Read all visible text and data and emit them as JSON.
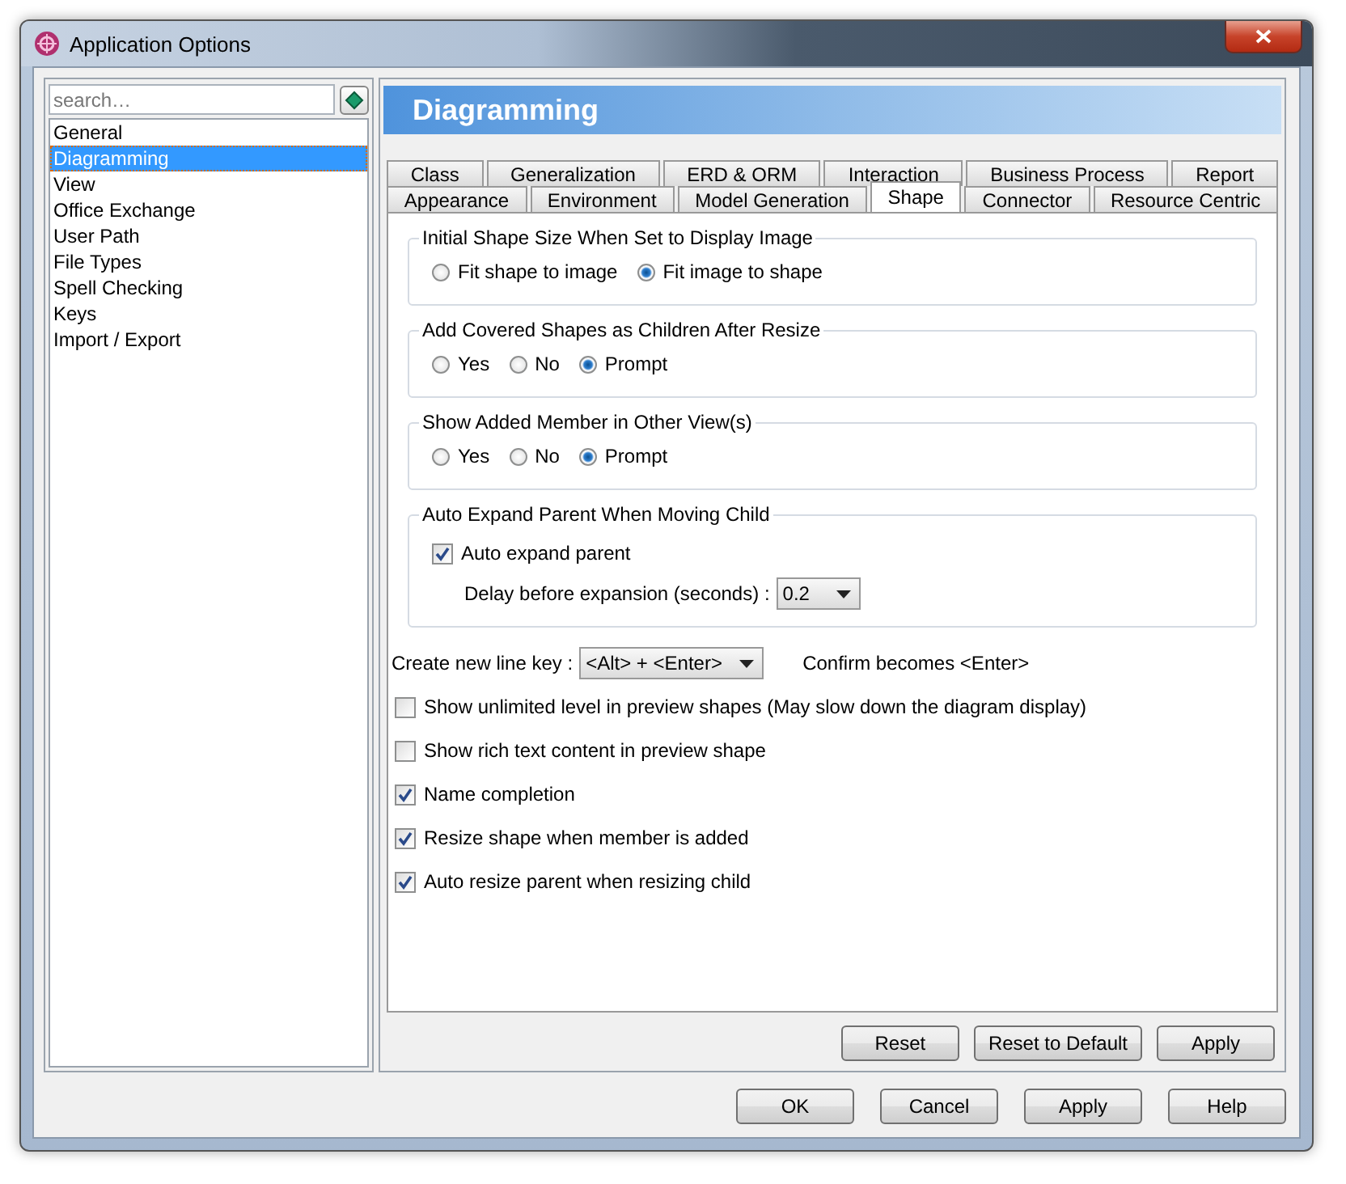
{
  "window": {
    "title": "Application Options"
  },
  "sidebar": {
    "search": {
      "placeholder": "search…"
    },
    "items": [
      {
        "label": "General",
        "selected": false
      },
      {
        "label": "Diagramming",
        "selected": true
      },
      {
        "label": "View",
        "selected": false
      },
      {
        "label": "Office Exchange",
        "selected": false
      },
      {
        "label": "User Path",
        "selected": false
      },
      {
        "label": "File Types",
        "selected": false
      },
      {
        "label": "Spell Checking",
        "selected": false
      },
      {
        "label": "Keys",
        "selected": false
      },
      {
        "label": "Import / Export",
        "selected": false
      }
    ]
  },
  "panel": {
    "title": "Diagramming",
    "tab_rows": [
      [
        {
          "label": "Class",
          "selected": false
        },
        {
          "label": "Generalization",
          "selected": false
        },
        {
          "label": "ERD & ORM",
          "selected": false
        },
        {
          "label": "Interaction",
          "selected": false
        },
        {
          "label": "Business Process",
          "selected": false
        },
        {
          "label": "Report",
          "selected": false
        }
      ],
      [
        {
          "label": "Appearance",
          "selected": false
        },
        {
          "label": "Environment",
          "selected": false
        },
        {
          "label": "Model Generation",
          "selected": false
        },
        {
          "label": "Shape",
          "selected": true
        },
        {
          "label": "Connector",
          "selected": false
        },
        {
          "label": "Resource Centric",
          "selected": false
        }
      ]
    ],
    "groups": [
      {
        "kind": "radios",
        "title": "Initial Shape Size When Set to Display Image",
        "options": [
          {
            "label": "Fit shape to image",
            "selected": false
          },
          {
            "label": "Fit image to shape",
            "selected": true
          }
        ]
      },
      {
        "kind": "radios",
        "title": "Add Covered Shapes as Children After Resize",
        "options": [
          {
            "label": "Yes",
            "selected": false
          },
          {
            "label": "No",
            "selected": false
          },
          {
            "label": "Prompt",
            "selected": true
          }
        ]
      },
      {
        "kind": "radios",
        "title": "Show Added Member in Other View(s)",
        "options": [
          {
            "label": "Yes",
            "selected": false
          },
          {
            "label": "No",
            "selected": false
          },
          {
            "label": "Prompt",
            "selected": true
          }
        ]
      },
      {
        "kind": "expand",
        "title": "Auto Expand Parent When Moving Child",
        "checkbox": {
          "label": "Auto expand parent",
          "checked": true
        },
        "delay": {
          "label": "Delay before expansion (seconds) :",
          "value": "0.2"
        }
      }
    ],
    "new_line_key": {
      "label": "Create new line key :",
      "value": "<Alt> + <Enter>",
      "note": "Confirm becomes <Enter>"
    },
    "options": [
      {
        "label": "Show unlimited level in preview shapes (May slow down the diagram display)",
        "checked": false
      },
      {
        "label": "Show rich text content in preview shape",
        "checked": false
      },
      {
        "label": "Name completion",
        "checked": true
      },
      {
        "label": "Resize shape when member is added",
        "checked": true
      },
      {
        "label": "Auto resize parent when resizing child",
        "checked": true
      }
    ],
    "buttons": [
      "Reset",
      "Reset to Default",
      "Apply"
    ]
  },
  "buttons": [
    "OK",
    "Cancel",
    "Apply",
    "Help"
  ]
}
